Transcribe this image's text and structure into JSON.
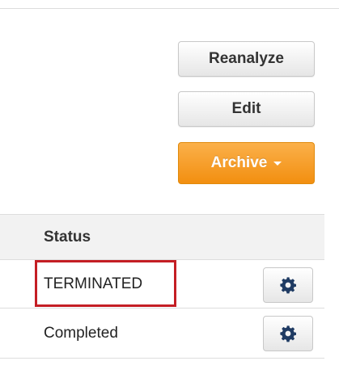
{
  "actions": {
    "reanalyze_label": "Reanalyze",
    "edit_label": "Edit",
    "archive_label": "Archive"
  },
  "table": {
    "header": {
      "status": "Status"
    },
    "rows": [
      {
        "status": "TERMINATED",
        "settings_icon": "gear-icon",
        "highlighted": true
      },
      {
        "status": "Completed",
        "settings_icon": "gear-icon",
        "highlighted": false
      }
    ]
  },
  "colors": {
    "archive_accent": "#f28f10",
    "highlight_border": "#c41e24",
    "icon": "#1f3b63"
  }
}
